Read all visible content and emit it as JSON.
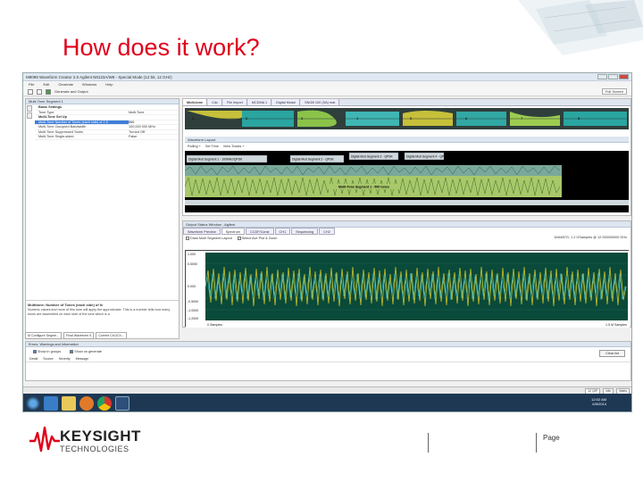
{
  "slide": {
    "title": "How does it work?",
    "page_label": "Page",
    "logo_word1": "KEYSIGHT",
    "logo_word2": "TECHNOLOGIES",
    "accent_color": "#e0001b"
  },
  "app": {
    "window_title": "M9099 Waveform Creator 2.0 Agilent N8123A/W8 - Special Mode (12 bit, 12 GHz)",
    "menu": [
      "File",
      "Edit",
      "Generate",
      "Windows",
      "Help"
    ],
    "toolbar_label": "Generate and Output",
    "full_screen_label": "Full Screen",
    "left_panel": {
      "title": "Multi-Tone Segment 1",
      "rows": [
        {
          "name": "Basic Settings",
          "value": "",
          "group": true
        },
        {
          "name": "Tone Type",
          "value": "Multi-Tone"
        },
        {
          "name": "Multi-Tone Set Up",
          "value": "",
          "group": true
        },
        {
          "name": "Multi-Tone Number of Tones (each side) of 2.5",
          "value": "500",
          "selected": true
        },
        {
          "name": "Multi-Tone Occupied Bandwidth",
          "value": "100.000 000 MHz"
        },
        {
          "name": "Multi-Tone Suppressed Tones",
          "value": "Turned Off"
        },
        {
          "name": "Multi-Tone Single-sided",
          "value": "False"
        }
      ],
      "desc_title": "Multitone: Number of Tones (each side) of fc",
      "desc_body": "Numeric values and more of this tone will apply the approximate. This is a number tells how many tones are assembled on each side of the tone which is a"
    },
    "bottom_tabs": [
      "M Configure Segme...",
      "Final Waveform S",
      "Current Ch1/Ch..."
    ],
    "segment_tabs": [
      "Multi-tone",
      "Cdc",
      "File Import",
      "MCDMA 1",
      "Digital Modul",
      "SNOB 100 (SA) mat"
    ],
    "segment_numbers": [
      "1",
      "2",
      "3",
      "4",
      "5",
      "6",
      "7",
      "8"
    ],
    "layout": {
      "title": "Waveform Layout",
      "controls": [
        "Rolling +",
        "Set Time",
        "View Tracks +"
      ],
      "labels": [
        "Digital Mod Segment 1 - 100MHz/QPSK",
        "Digital Mod Segment 2 - QPSK",
        "Digital Mod Segment 3 - QPSK",
        "Digital Mod Segment 4 - QPSK"
      ],
      "bottom_label": "Multi-Tone Segment 1 - 500 tones"
    },
    "output": {
      "title": "Output Status Window - Agilent",
      "tabs": [
        "Waveform Preview",
        "Spectrum",
        "CCDF/Const",
        "CH1",
        "Sequencing",
        "CH2"
      ],
      "checks": [
        "Draw Multi Segment Layout",
        "Select Ave Plot & Zoom"
      ],
      "info": "1M4657G, 1.2 GSamples @ 12.000000000 GHz",
      "y_ticks": [
        "1.000",
        "0.5000",
        "0.000",
        "-0.5000",
        "-1.0000",
        "-1.2000"
      ],
      "x_left": "0 Samples",
      "x_right": "1.5 M Samples"
    },
    "errors": {
      "title": "Errors, Warnings and Information",
      "checks": [
        "Show in groups",
        "Show on generate"
      ],
      "clear_label": "Clear list",
      "headers": [
        "Detail",
        "Source",
        "Severity",
        "Message"
      ]
    },
    "status_boxes": [
      "12 QIP",
      "Idle",
      "Waits"
    ],
    "tray": {
      "time": "12:02 AM",
      "date": "6/5/2014"
    }
  }
}
